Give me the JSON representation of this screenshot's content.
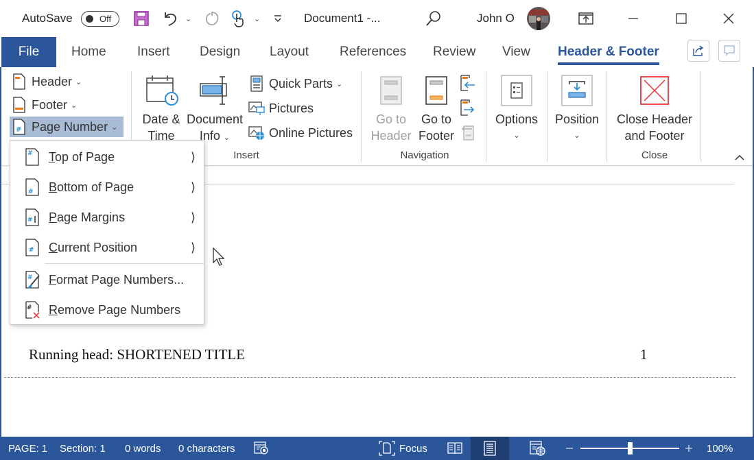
{
  "titlebar": {
    "autosave_label": "AutoSave",
    "autosave_state": "Off",
    "document_title": "Document1  -...",
    "user_name": "John O",
    "icons": [
      "save-icon",
      "undo-icon",
      "redo-icon",
      "touch-mode-icon",
      "customize-qat-icon",
      "search-icon",
      "ribbon-display-icon",
      "minimize-icon",
      "maximize-icon",
      "close-icon"
    ]
  },
  "tabs": {
    "items": [
      {
        "label": "File"
      },
      {
        "label": "Home"
      },
      {
        "label": "Insert"
      },
      {
        "label": "Design"
      },
      {
        "label": "Layout"
      },
      {
        "label": "References"
      },
      {
        "label": "Review"
      },
      {
        "label": "View"
      },
      {
        "label": "Header & Footer",
        "active": true
      }
    ],
    "share_icon": "share-icon",
    "comments_icon": "comments-icon"
  },
  "ribbon": {
    "header_footer_group": {
      "header": "Header",
      "footer": "Footer",
      "page_number": "Page Number"
    },
    "insert_group": {
      "label": "Insert",
      "date_time_line1": "Date &",
      "date_time_line2": "Time",
      "doc_info_line1": "Document",
      "doc_info_line2": "Info",
      "quick_parts": "Quick Parts",
      "pictures": "Pictures",
      "online_pictures": "Online Pictures"
    },
    "navigation_group": {
      "label": "Navigation",
      "go_to_header_line1": "Go to",
      "go_to_header_line2": "Header",
      "go_to_footer_line1": "Go to",
      "go_to_footer_line2": "Footer"
    },
    "options": "Options",
    "position": "Position",
    "close_group": {
      "label": "Close",
      "close_line1": "Close Header",
      "close_line2": "and Footer"
    }
  },
  "menu": {
    "items": [
      {
        "key": "T",
        "rest": "op of Page",
        "submenu": true
      },
      {
        "key": "B",
        "rest": "ottom of Page",
        "submenu": true
      },
      {
        "key": "P",
        "rest": "age Margins",
        "submenu": true
      },
      {
        "key": "C",
        "rest": "urrent Position",
        "submenu": true
      },
      {
        "key": "F",
        "rest": "ormat Page Numbers...",
        "submenu": false
      },
      {
        "key": "R",
        "rest": "emove Page Numbers",
        "submenu": false
      }
    ]
  },
  "document": {
    "running_head": "Running head: SHORTENED TITLE",
    "page_number": "1"
  },
  "status": {
    "page": "PAGE: 1",
    "section": "Section: 1",
    "words": "0 words",
    "characters": "0 characters",
    "focus": "Focus",
    "zoom_level": "100%",
    "zoom_fraction": 0.5
  },
  "colors": {
    "accent": "#2b579a",
    "selected_button": "#a8bcd6",
    "close_red": "#e8474b",
    "orange": "#e87b16",
    "blue_icon": "#2b8fd6"
  }
}
